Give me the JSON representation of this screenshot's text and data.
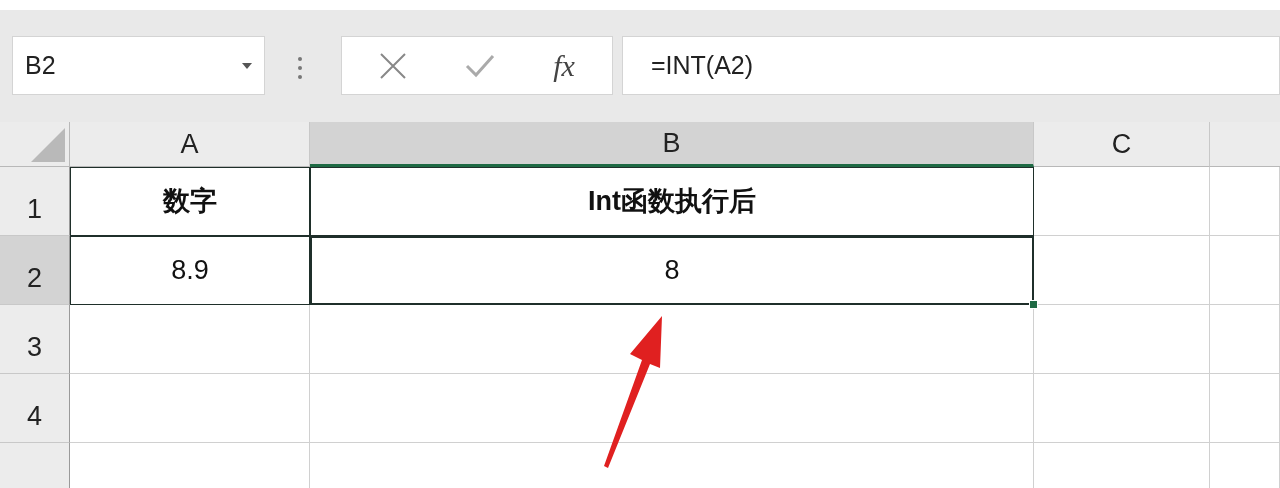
{
  "name_box": {
    "value": "B2"
  },
  "formula_bar": {
    "buttons": [
      {
        "kind": "cancel"
      },
      {
        "kind": "enter"
      },
      {
        "kind": "function",
        "label": "fx"
      }
    ],
    "value": "=INT(A2)"
  },
  "columns": [
    {
      "label": "A",
      "selected": false
    },
    {
      "label": "B",
      "selected": true
    },
    {
      "label": "C",
      "selected": false
    }
  ],
  "rows": [
    {
      "label": "1",
      "selected": false,
      "header": true,
      "cells": [
        {
          "text": "数字",
          "selected": false
        },
        {
          "text": "Int函数执行后",
          "selected": false
        }
      ]
    },
    {
      "label": "2",
      "selected": true,
      "header": false,
      "cells": [
        {
          "text": "8.9",
          "selected": false
        },
        {
          "text": "8",
          "selected": true
        }
      ]
    },
    {
      "label": "3",
      "selected": false
    },
    {
      "label": "4",
      "selected": false
    }
  ]
}
